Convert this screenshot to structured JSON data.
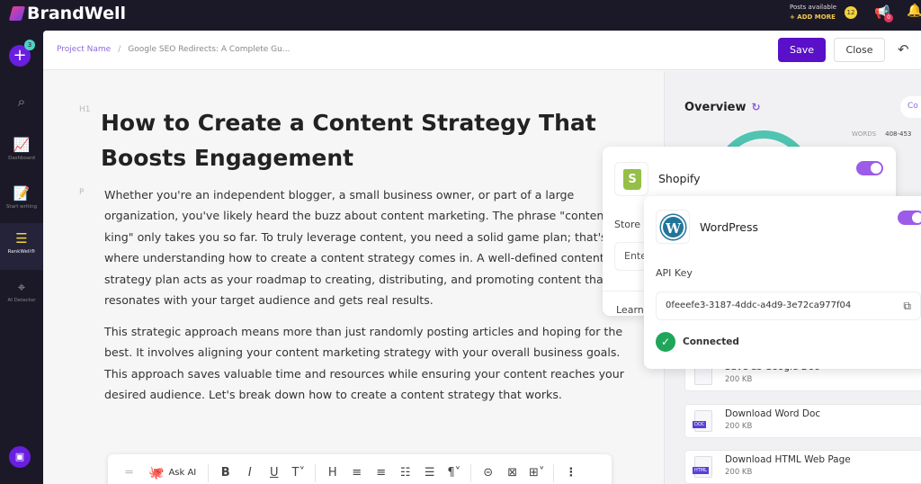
{
  "brand": "BrandWell",
  "topbar": {
    "posts_label": "Posts available",
    "add_more": "+ ADD MORE",
    "posts_count": "12",
    "notif_count": "0"
  },
  "sidebar": {
    "new_badge": "3",
    "items": [
      {
        "label": "",
        "icon": "search-icon"
      },
      {
        "label": "Dashboard",
        "icon": "chart-icon"
      },
      {
        "label": "Start writing",
        "icon": "document-icon"
      },
      {
        "label": "RankWell®",
        "icon": "layers-icon"
      },
      {
        "label": "AI Detector",
        "icon": "scan-icon"
      }
    ]
  },
  "breadcrumb": {
    "project": "Project Name",
    "sep": "/",
    "current": "Google SEO Redirects: A Complete Gu..."
  },
  "header": {
    "save": "Save",
    "close": "Close"
  },
  "editor": {
    "h1_tag": "H1",
    "p_tag": "P",
    "title": "How to Create a Content Strategy That Boosts Engagement",
    "paragraphs": [
      "Whether you're an independent blogger, a small business owner, or part of a large organization, you've likely heard the buzz about content marketing. The phrase \"content king\" only takes you so far. To truly leverage content, you need a solid game plan; that's where understanding how to create a content strategy comes in. A well-defined content strategy plan acts as your roadmap to creating, distributing, and promoting content that resonates with your target audience and gets real results.",
      "This strategic approach means more than just randomly posting articles and hoping for the best. It involves aligning your content marketing strategy with your overall business goals. This approach saves valuable time and resources while ensuring your content reaches your desired audience. Let's break down how to create a content strategy that works."
    ],
    "toolbar": {
      "ask_ai": "Ask AI"
    }
  },
  "overview": {
    "title": "Overview",
    "button": "Co",
    "words_label": "WORDS",
    "words_range": "408-453"
  },
  "downloads": [
    {
      "title": "Save as Google Doc",
      "size": "200 KB",
      "badge": ""
    },
    {
      "title": "Download Word Doc",
      "size": "200 KB",
      "badge": "DOC"
    },
    {
      "title": "Download HTML Web Page",
      "size": "200 KB",
      "badge": "HTML"
    }
  ],
  "shopify": {
    "name": "Shopify",
    "enabled": true,
    "store_label": "Store",
    "input_placeholder": "Enter",
    "learn": "Learn"
  },
  "wordpress": {
    "name": "WordPress",
    "enabled": true,
    "api_key_label": "API Key",
    "api_key": "0feeefe3-3187-4ddc-a4d9-3e72ca977f04",
    "status": "Connected"
  },
  "colors": {
    "accent": "#5a0fc8",
    "toggle": "#9c5ce8",
    "connected": "#1fa65a",
    "shopify": "#95bf47",
    "wordpress": "#21759b"
  }
}
